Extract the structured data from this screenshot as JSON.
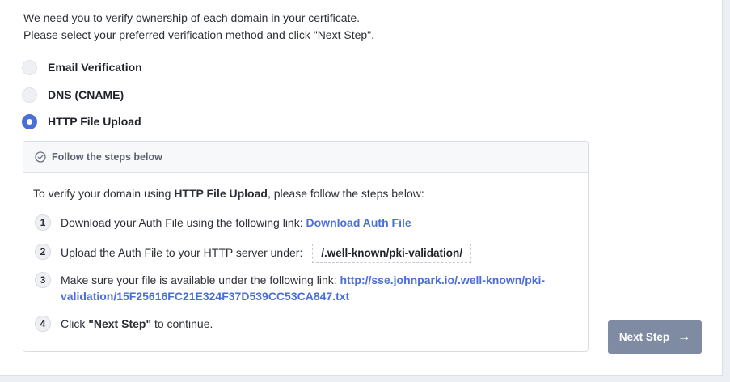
{
  "intro": {
    "line1": "We need you to verify ownership of each domain in your certificate.",
    "line2": "Please select your preferred verification method and click \"Next Step\"."
  },
  "methods": [
    {
      "label": "Email Verification",
      "selected": false
    },
    {
      "label": "DNS (CNAME)",
      "selected": false
    },
    {
      "label": "HTTP File Upload",
      "selected": true
    }
  ],
  "panel": {
    "icon": "check-circle-icon",
    "title": "Follow the steps below",
    "lead_prefix": "To verify your domain using ",
    "lead_bold": "HTTP File Upload",
    "lead_suffix": ", please follow the steps below:",
    "steps": [
      {
        "num": "1",
        "text": "Download your Auth File using the following link: ",
        "link": "Download Auth File"
      },
      {
        "num": "2",
        "text": "Upload the Auth File to your HTTP server under: ",
        "code": "/.well-known/pki-validation/"
      },
      {
        "num": "3",
        "text": "Make sure your file is available under the following link: ",
        "link_line1": "http://sse.johnpark.io/.well-known/pki-",
        "link_line2": "validation/15F25616FC21E324F37D539CC53CA847.txt"
      },
      {
        "num": "4",
        "text_prefix": "Click ",
        "bold": "\"Next Step\"",
        "text_suffix": " to continue."
      }
    ]
  },
  "next_button": {
    "label": "Next Step",
    "icon": "arrow-right-icon"
  },
  "colors": {
    "accent": "#4a6fd6",
    "button": "#7f8aa3"
  }
}
